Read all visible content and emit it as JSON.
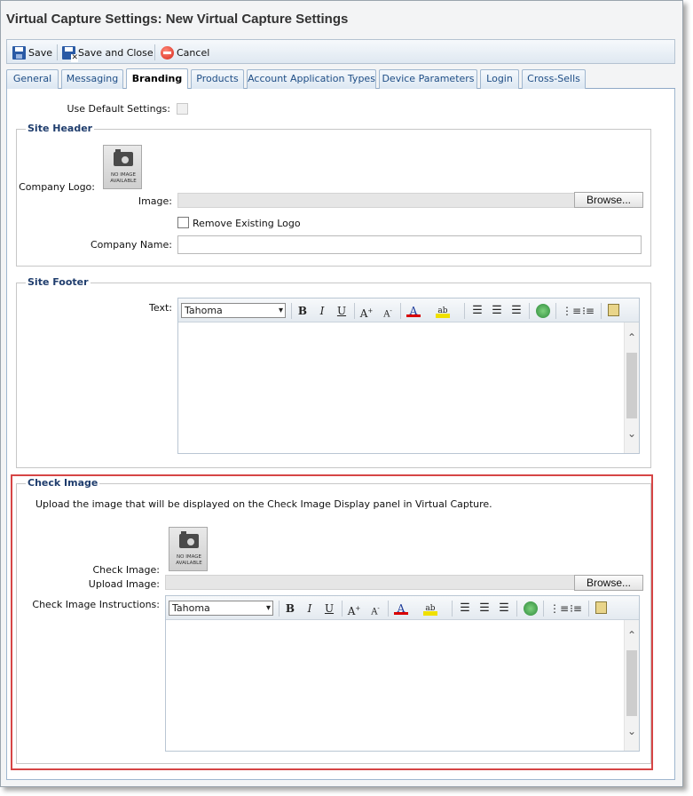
{
  "window": {
    "title": "Virtual Capture Settings: New Virtual Capture Settings"
  },
  "toolbar": {
    "save_label": "Save",
    "save_close_label": "Save and Close",
    "cancel_label": "Cancel"
  },
  "tabs": [
    {
      "label": "General"
    },
    {
      "label": "Messaging"
    },
    {
      "label": "Branding"
    },
    {
      "label": "Products"
    },
    {
      "label": "Account Application Types"
    },
    {
      "label": "Device Parameters"
    },
    {
      "label": "Login"
    },
    {
      "label": "Cross-Sells"
    }
  ],
  "active_tab": "Branding",
  "form": {
    "use_default_label": "Use Default Settings:"
  },
  "site_header": {
    "legend": "Site Header",
    "company_logo_label": "Company Logo:",
    "no_image_line1": "NO IMAGE",
    "no_image_line2": "AVAILABLE",
    "image_label": "Image:",
    "browse_label": "Browse...",
    "remove_logo_label": "Remove Existing Logo",
    "company_name_label": "Company Name:",
    "company_name_value": ""
  },
  "site_footer": {
    "legend": "Site Footer",
    "text_label": "Text:",
    "font": "Tahoma"
  },
  "check_image": {
    "legend": "Check Image",
    "description": "Upload the image that will be displayed on the Check Image Display panel in Virtual Capture.",
    "check_image_label": "Check Image:",
    "no_image_line1": "NO IMAGE",
    "no_image_line2": "AVAILABLE",
    "upload_image_label": "Upload Image:",
    "browse_label": "Browse...",
    "instructions_label": "Check Image Instructions:",
    "font": "Tahoma"
  },
  "colors": {
    "highlight": "#d64545",
    "tab_text": "#1f4e86",
    "legend": "#1f3d6d"
  },
  "editor_icons": [
    "bold-icon",
    "italic-icon",
    "underline-icon",
    "grow-font-icon",
    "shrink-font-icon",
    "font-color-icon",
    "highlight-color-icon",
    "align-left-icon",
    "align-center-icon",
    "align-right-icon",
    "insert-image-icon",
    "numbered-list-icon",
    "bulleted-list-icon",
    "paste-word-icon"
  ]
}
